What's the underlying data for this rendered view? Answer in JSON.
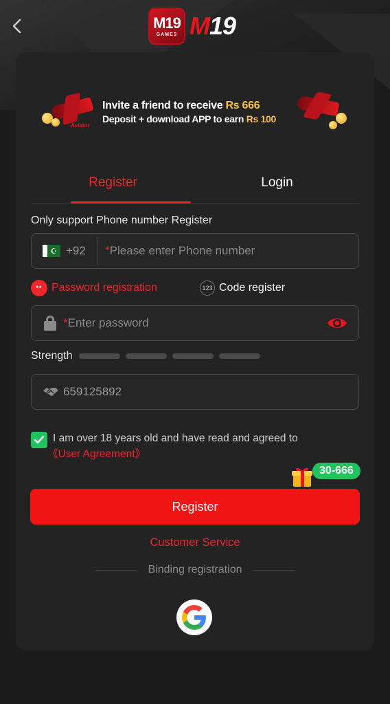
{
  "app": {
    "logo_badge_text": "M19",
    "logo_badge_sub": "GAMES",
    "logo_text_m": "M",
    "logo_text_num": "19"
  },
  "banner": {
    "line1_prefix": "Invite a friend to receive ",
    "line1_amount": "Rs 666",
    "line2_prefix": "Deposit + download APP to earn ",
    "line2_amount": "Rs 100",
    "game_label": "Aviator"
  },
  "tabs": [
    {
      "label": "Register",
      "active": true
    },
    {
      "label": "Login",
      "active": false
    }
  ],
  "form": {
    "support_label": "Only support Phone number Register",
    "phone": {
      "country_code": "+92",
      "required_mark": "*",
      "placeholder": "Please enter Phone number"
    },
    "modes": {
      "password_icon": "**",
      "password_label": "Password registration",
      "code_icon": "123",
      "code_label": "Code register"
    },
    "password": {
      "required_mark": "*",
      "placeholder": "Enter password"
    },
    "strength": {
      "label": "Strength",
      "level": 0
    },
    "invite_code": "659125892",
    "agreement": {
      "checked": true,
      "text": "I am over 18 years old and have read and agreed to",
      "link": "《User Agreement》"
    }
  },
  "promo": {
    "badge": "30-666"
  },
  "actions": {
    "register_label": "Register",
    "customer_service": "Customer Service",
    "binding_label": "Binding registration"
  },
  "colors": {
    "accent": "#f0262c",
    "button": "#f01414",
    "check": "#22c35e",
    "card": "#232323",
    "background": "#1b1b1b"
  }
}
